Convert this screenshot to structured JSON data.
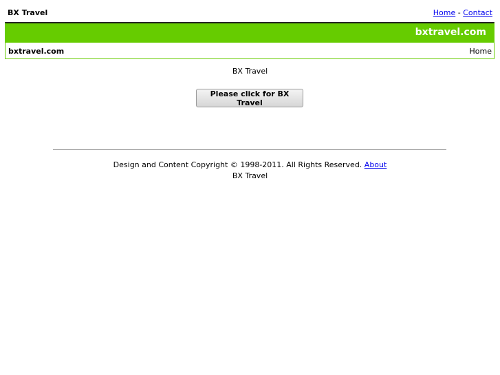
{
  "header": {
    "site_title": "BX Travel",
    "nav": {
      "home": "Home",
      "separator": " - ",
      "contact": "Contact"
    }
  },
  "banner": {
    "domain": "bxtravel.com",
    "breadcrumb_left": "bxtravel.com",
    "breadcrumb_right": "Home",
    "accent_color": "#66cc00"
  },
  "main": {
    "heading": "BX Travel",
    "button_label": "Please click for BX Travel"
  },
  "footer": {
    "copyright": "Design and Content Copyright © 1998-2011. All Rights Reserved. ",
    "about_link": "About",
    "site_name": "BX Travel"
  }
}
